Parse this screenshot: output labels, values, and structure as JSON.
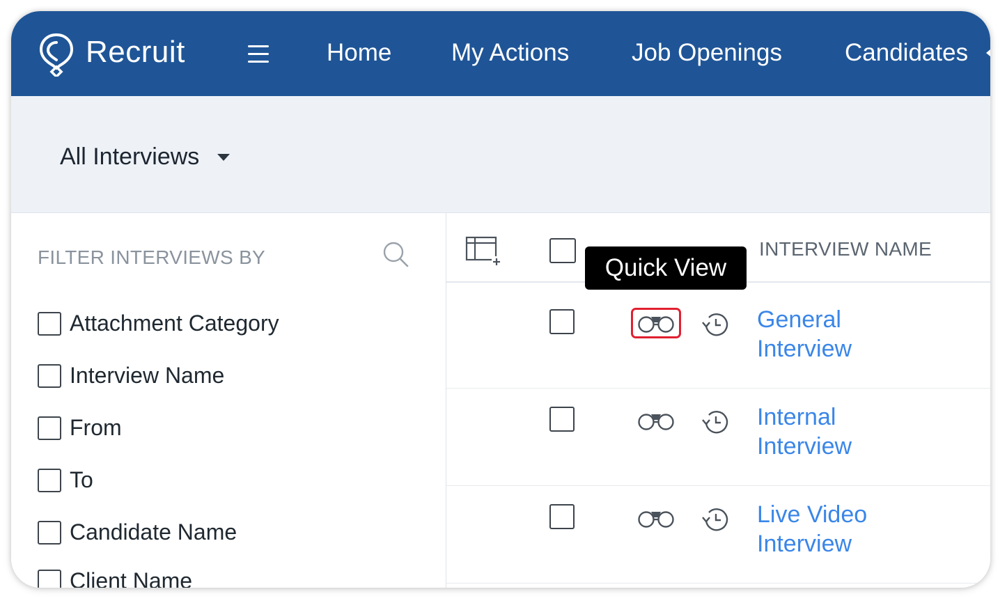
{
  "app": {
    "brand": "Recruit",
    "colors": {
      "nav_bg": "#1f5597",
      "link": "#3a86e8",
      "highlight": "#e02030"
    }
  },
  "nav": {
    "items": [
      "Home",
      "My Actions",
      "Job Openings",
      "Candidates"
    ]
  },
  "view": {
    "selected": "All Interviews"
  },
  "filter": {
    "heading": "FILTER INTERVIEWS BY",
    "items": [
      "Attachment Category",
      "Interview Name",
      "From",
      "To",
      "Candidate Name",
      "Client Name"
    ]
  },
  "list": {
    "column_title": "INTERVIEW NAME",
    "rows": [
      {
        "name_line1": "General",
        "name_line2": "Interview"
      },
      {
        "name_line1": "Internal",
        "name_line2": "Interview"
      },
      {
        "name_line1": "Live Video",
        "name_line2": "Interview"
      }
    ]
  },
  "tooltip": {
    "text": "Quick View"
  },
  "icons": {
    "logo": "recruit-logo-icon",
    "menu": "hamburger-menu-icon",
    "search": "search-icon",
    "columns": "column-settings-icon",
    "quick_view": "binoculars-icon",
    "history": "history-icon"
  }
}
